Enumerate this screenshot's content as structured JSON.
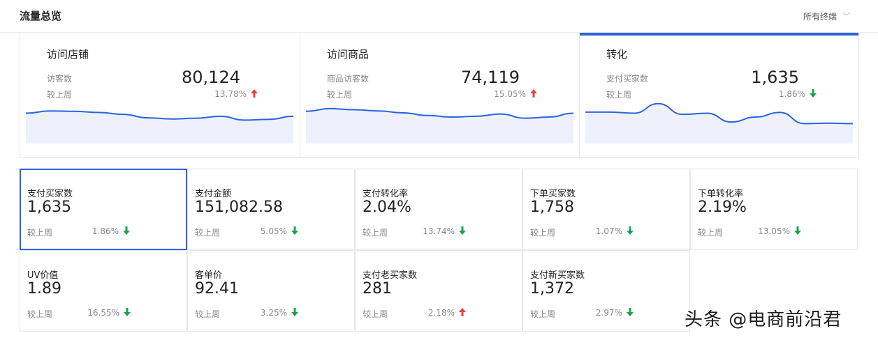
{
  "header": {
    "title": "流量总览",
    "terminal_label": "所有终端"
  },
  "overview": [
    {
      "title": "访问店铺",
      "metric": "访客数",
      "value": "80,124",
      "compare": "较上周",
      "pct": "13.78%",
      "trend": "up",
      "active": false,
      "series": [
        0.7,
        0.76,
        0.75,
        0.72,
        0.67,
        0.58,
        0.55,
        0.57,
        0.62,
        0.52,
        0.54,
        0.62
      ]
    },
    {
      "title": "访问商品",
      "metric": "商品访客数",
      "value": "74,119",
      "compare": "较上周",
      "pct": "15.05%",
      "trend": "up",
      "active": false,
      "series": [
        0.75,
        0.82,
        0.79,
        0.76,
        0.71,
        0.64,
        0.6,
        0.62,
        0.68,
        0.57,
        0.6,
        0.7
      ]
    },
    {
      "title": "转化",
      "metric": "支付买家数",
      "value": "1,635",
      "compare": "较上周",
      "pct": "1.86%",
      "trend": "down",
      "active": true,
      "series": [
        0.73,
        0.73,
        0.7,
        0.95,
        0.67,
        0.7,
        0.47,
        0.6,
        0.72,
        0.43,
        0.44,
        0.43
      ]
    }
  ],
  "metrics": [
    {
      "label": "支付买家数",
      "value": "1,635",
      "compare": "较上周",
      "pct": "1.86%",
      "trend": "down",
      "selected": true
    },
    {
      "label": "支付金额",
      "value": "151,082.58",
      "compare": "较上周",
      "pct": "5.05%",
      "trend": "down",
      "selected": false
    },
    {
      "label": "支付转化率",
      "value": "2.04%",
      "compare": "较上周",
      "pct": "13.74%",
      "trend": "down",
      "selected": false
    },
    {
      "label": "下单买家数",
      "value": "1,758",
      "compare": "较上周",
      "pct": "1.07%",
      "trend": "down",
      "selected": false
    },
    {
      "label": "下单转化率",
      "value": "2.19%",
      "compare": "较上周",
      "pct": "13.05%",
      "trend": "down",
      "selected": false
    },
    {
      "label": "UV价值",
      "value": "1.89",
      "compare": "较上周",
      "pct": "16.55%",
      "trend": "down",
      "selected": false
    },
    {
      "label": "客单价",
      "value": "92.41",
      "compare": "较上周",
      "pct": "3.25%",
      "trend": "down",
      "selected": false
    },
    {
      "label": "支付老买家数",
      "value": "281",
      "compare": "较上周",
      "pct": "2.18%",
      "trend": "up",
      "selected": false
    },
    {
      "label": "支付新买家数",
      "value": "1,372",
      "compare": "较上周",
      "pct": "2.97%",
      "trend": "down",
      "selected": false
    }
  ],
  "colors": {
    "accent": "#2a63e0",
    "up": "#e8413c",
    "down": "#1aa34a",
    "area": "#eef1fb"
  },
  "watermark": "头条 @电商前沿君"
}
